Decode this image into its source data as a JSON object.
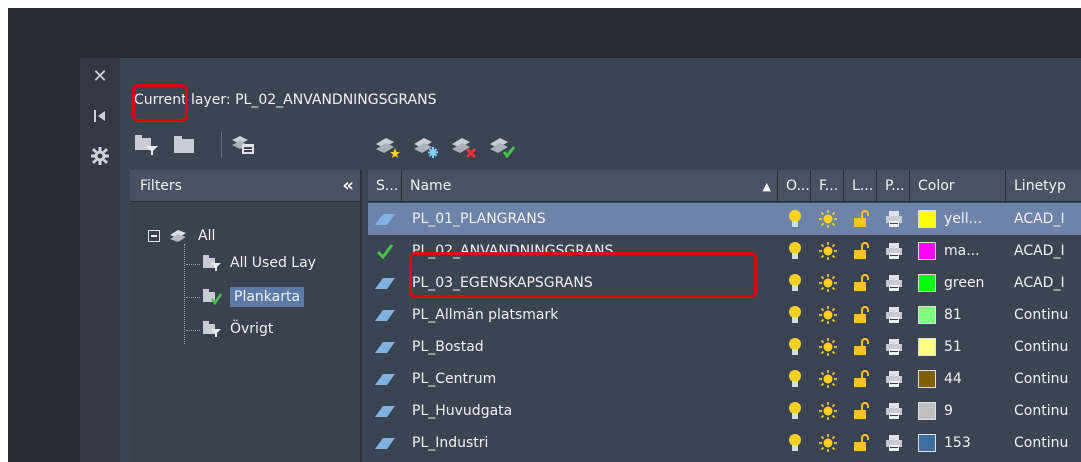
{
  "current_layer_text": "Current layer: PL_02_ANVANDNINGSGRANS",
  "side_icons": [
    "close-icon",
    "pin-icon",
    "settings-icon"
  ],
  "filters": {
    "title": "Filters",
    "root_label": "All",
    "children": [
      "All Used Lay",
      "Plankarta",
      "Övrigt"
    ],
    "selected": "Plankarta"
  },
  "columns": {
    "status": "S...",
    "name": "Name",
    "on": "O...",
    "freeze": "F...",
    "lock": "L...",
    "plot": "P...",
    "color": "Color",
    "linetype": "Linetyp"
  },
  "rows": [
    {
      "name": "PL_01_PLANGRANS",
      "color_label": "yell...",
      "color_hex": "#ffff00",
      "linetype": "ACAD_I",
      "current": false,
      "selected": true
    },
    {
      "name": "PL_02_ANVANDNINGSGRANS",
      "color_label": "ma...",
      "color_hex": "#ff00ff",
      "linetype": "ACAD_I",
      "current": true,
      "selected": false
    },
    {
      "name": "PL_03_EGENSKAPSGRANS",
      "color_label": "green",
      "color_hex": "#00ff00",
      "linetype": "ACAD_I",
      "current": false,
      "selected": false
    },
    {
      "name": "PL_Allmän platsmark",
      "color_label": "81",
      "color_hex": "#7fff7f",
      "linetype": "Continu",
      "current": false,
      "selected": false
    },
    {
      "name": "PL_Bostad",
      "color_label": "51",
      "color_hex": "#ffff7f",
      "linetype": "Continu",
      "current": false,
      "selected": false
    },
    {
      "name": "PL_Centrum",
      "color_label": "44",
      "color_hex": "#7f5f00",
      "linetype": "Continu",
      "current": false,
      "selected": false
    },
    {
      "name": "PL_Huvudgata",
      "color_label": "9",
      "color_hex": "#c0c0c0",
      "linetype": "Continu",
      "current": false,
      "selected": false
    },
    {
      "name": "PL_Industri",
      "color_label": "153",
      "color_hex": "#3f6f9f",
      "linetype": "Continu",
      "current": false,
      "selected": false
    }
  ],
  "colors": {
    "accent_selection": "#6d83a8",
    "highlight_box": "#e3000f",
    "current_check": "#4cc04c"
  }
}
